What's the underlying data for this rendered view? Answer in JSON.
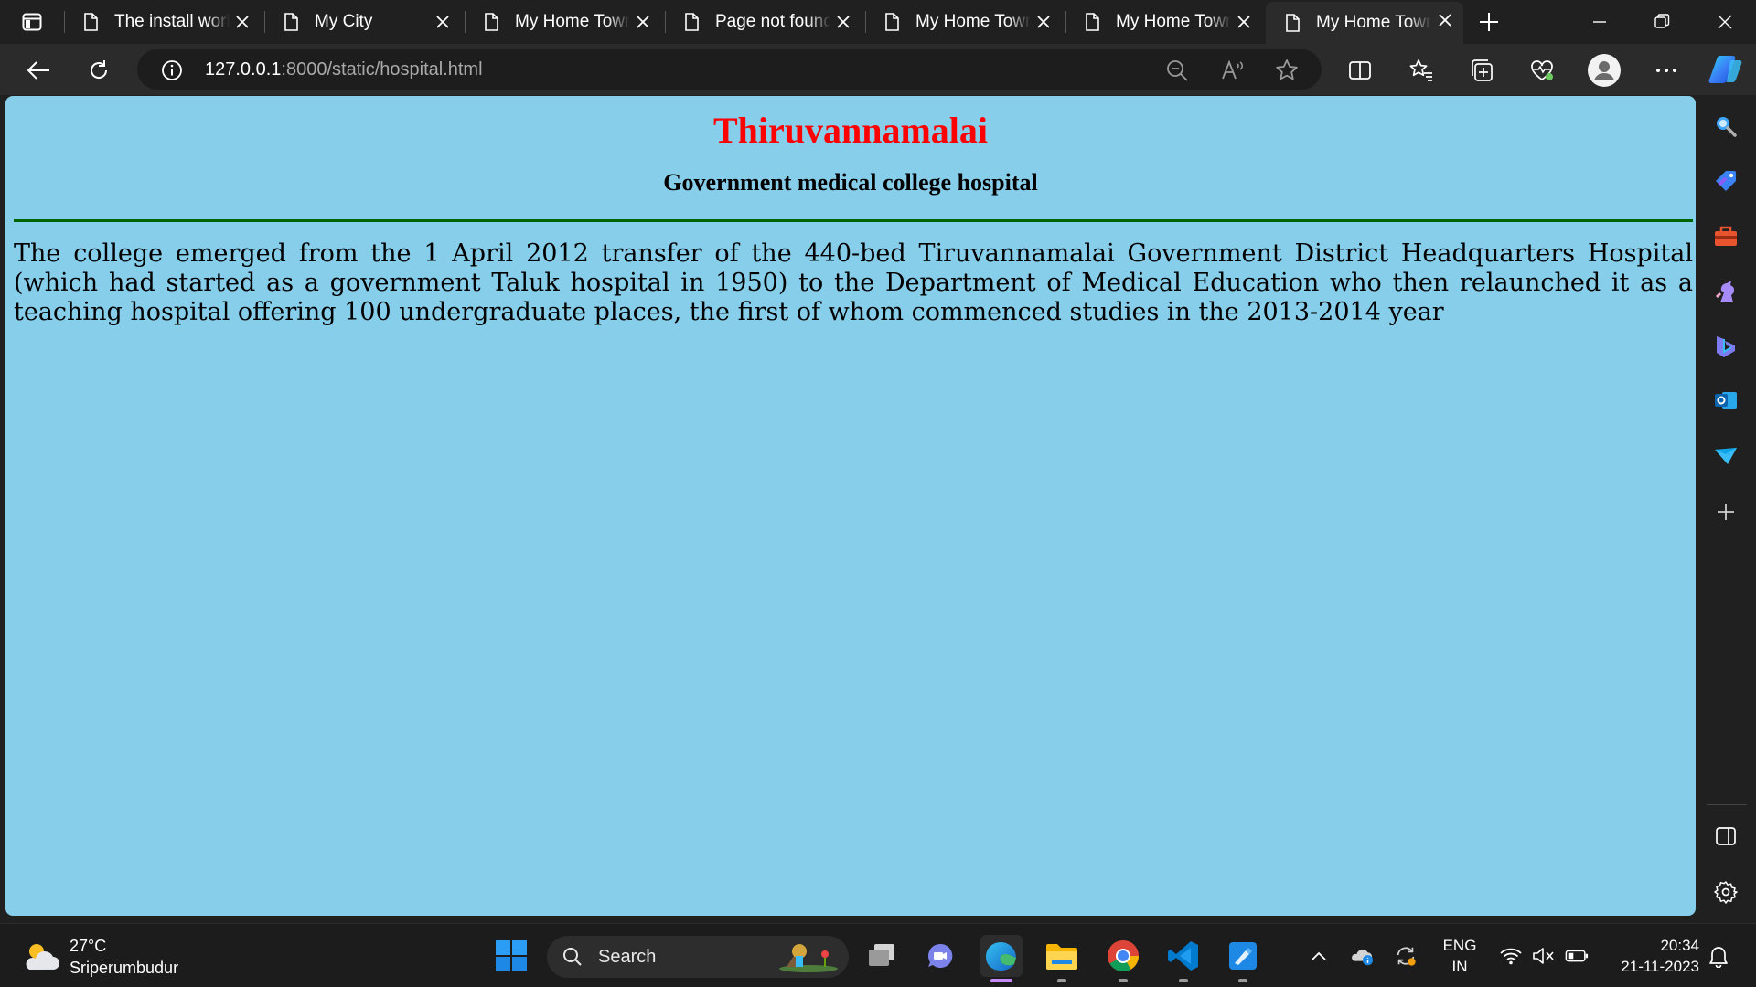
{
  "browser": {
    "tabs": [
      {
        "title": "The install work",
        "active": false
      },
      {
        "title": "My City",
        "active": false
      },
      {
        "title": "My Home Town",
        "active": false
      },
      {
        "title": "Page not found",
        "active": false
      },
      {
        "title": "My Home Town",
        "active": false
      },
      {
        "title": "My Home Town",
        "active": false
      },
      {
        "title": "My Home Town",
        "active": true
      }
    ],
    "address": {
      "host": "127.0.0.1",
      "path": ":8000/static/hospital.html"
    }
  },
  "page": {
    "title": "Thiruvannamalai",
    "subtitle": "Government medical college hospital",
    "body": "The college emerged from the 1 April 2012 transfer of the 440-bed Tiruvannamalai Government District Headquarters Hospital (which had started as a government Taluk hospital in 1950) to the Department of Medical Education who then relaunched it as a teaching hospital offering 100 undergraduate places, the first of whom commenced studies in the 2013-2014 year",
    "colors": {
      "background": "#87ceeb",
      "title": "#ff0000",
      "rule": "#006400"
    }
  },
  "taskbar": {
    "weather": {
      "temperature": "27°C",
      "location": "Sriperumbudur"
    },
    "search_label": "Search",
    "language": {
      "line1": "ENG",
      "line2": "IN"
    },
    "clock": {
      "time": "20:34",
      "date": "21-11-2023"
    }
  }
}
